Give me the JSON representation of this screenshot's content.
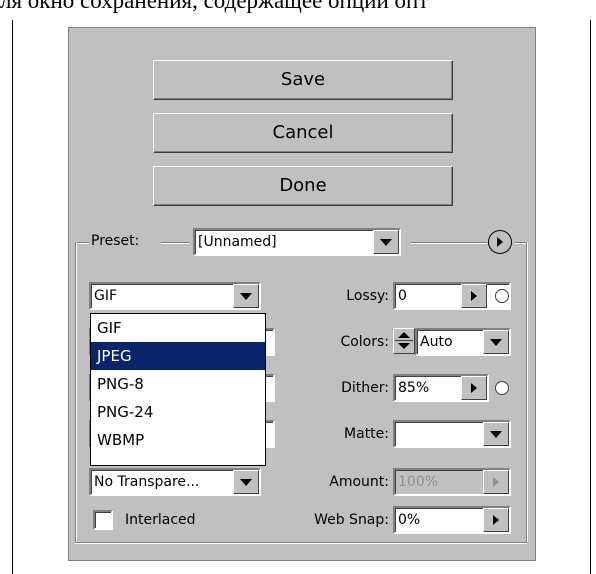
{
  "caption": "ля окно сохранения, содержащее опции опт",
  "buttons": {
    "save": "Save",
    "cancel": "Cancel",
    "done": "Done"
  },
  "preset": {
    "label": "Preset:",
    "value": "[Unnamed]"
  },
  "format": {
    "selected": "GIF",
    "options": [
      "GIF",
      "JPEG",
      "PNG-8",
      "PNG-24",
      "WBMP"
    ],
    "highlighted": "JPEG"
  },
  "lossy": {
    "label": "Lossy:",
    "value": "0"
  },
  "colors": {
    "label": "Colors:",
    "value": "Auto"
  },
  "dither": {
    "label": "Dither:",
    "value": "85%"
  },
  "matte": {
    "label": "Matte:",
    "value": ""
  },
  "transparency": {
    "value": "No Transpare..."
  },
  "amount": {
    "label": "Amount:",
    "value": "100%"
  },
  "interlaced": {
    "label": "Interlaced",
    "checked": false
  },
  "websnap": {
    "label": "Web Snap:",
    "value": "0%"
  },
  "colors_ui": {
    "panel": "#c0c0c0",
    "selection": "#0a246a"
  },
  "icons": [
    "dropdown-arrow-icon",
    "right-arrow-icon",
    "play-circle-icon",
    "spinner-icon",
    "eyedropper-radio-icon"
  ]
}
